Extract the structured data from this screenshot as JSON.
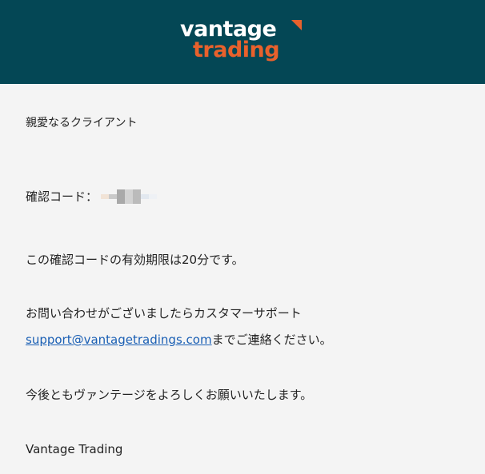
{
  "header": {
    "logo_line1": "vantage",
    "logo_line2": "trading",
    "bg_color": "#044755",
    "accent_color": "#e8612c"
  },
  "email": {
    "greeting": "親愛なるクライアント",
    "code_label": "確認コード：",
    "expiry_text": "この確認コードの有効期限は20分です。",
    "contact_line1": "お問い合わせがございましたらカスタマーサポート",
    "support_email": "support@vantagetradings.com",
    "contact_line2_suffix": "までご連絡ください。",
    "closing": "今後ともヴァンテージをよろしくお願いいたします。",
    "signature": "Vantage Trading"
  }
}
